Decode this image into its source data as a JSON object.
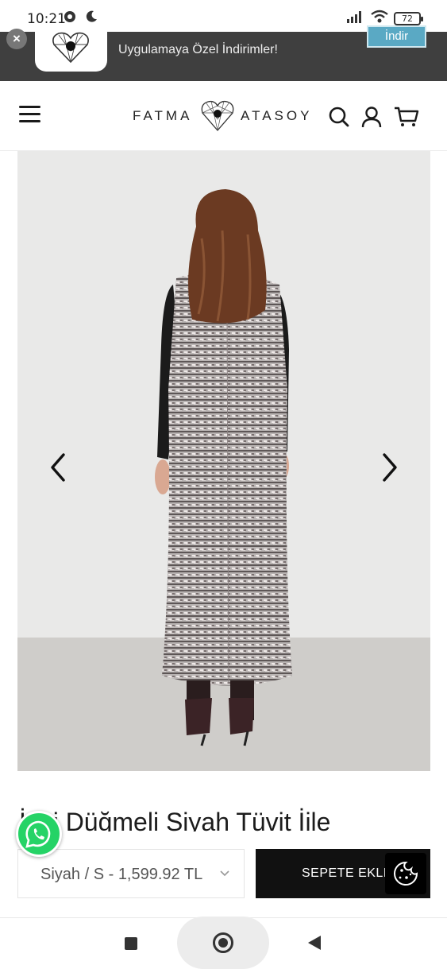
{
  "status_bar": {
    "time": "10:21",
    "battery": "72"
  },
  "app_banner": {
    "text": "Uygulamaya Özel İndirimler!",
    "button_label": "İndir",
    "close_label": "×"
  },
  "header": {
    "brand_left": "FATMA",
    "brand_right": "ATASOY"
  },
  "product": {
    "title": "İnci Düğmeli Siyah Tüvit İile",
    "selected_variant": "Siyah / S - 1,599.92 TL",
    "add_to_cart_label": "SEPETE EKLE"
  },
  "colors": {
    "banner_bg": "#3f3f3f",
    "banner_button": "#5aa9c4",
    "cta_bg": "#111111",
    "whatsapp": "#25d366"
  },
  "icons": [
    "close-icon",
    "menu-icon",
    "search-icon",
    "user-icon",
    "cart-icon",
    "chevron-left-icon",
    "chevron-right-icon",
    "chevron-down-icon",
    "cookie-icon",
    "whatsapp-icon"
  ]
}
